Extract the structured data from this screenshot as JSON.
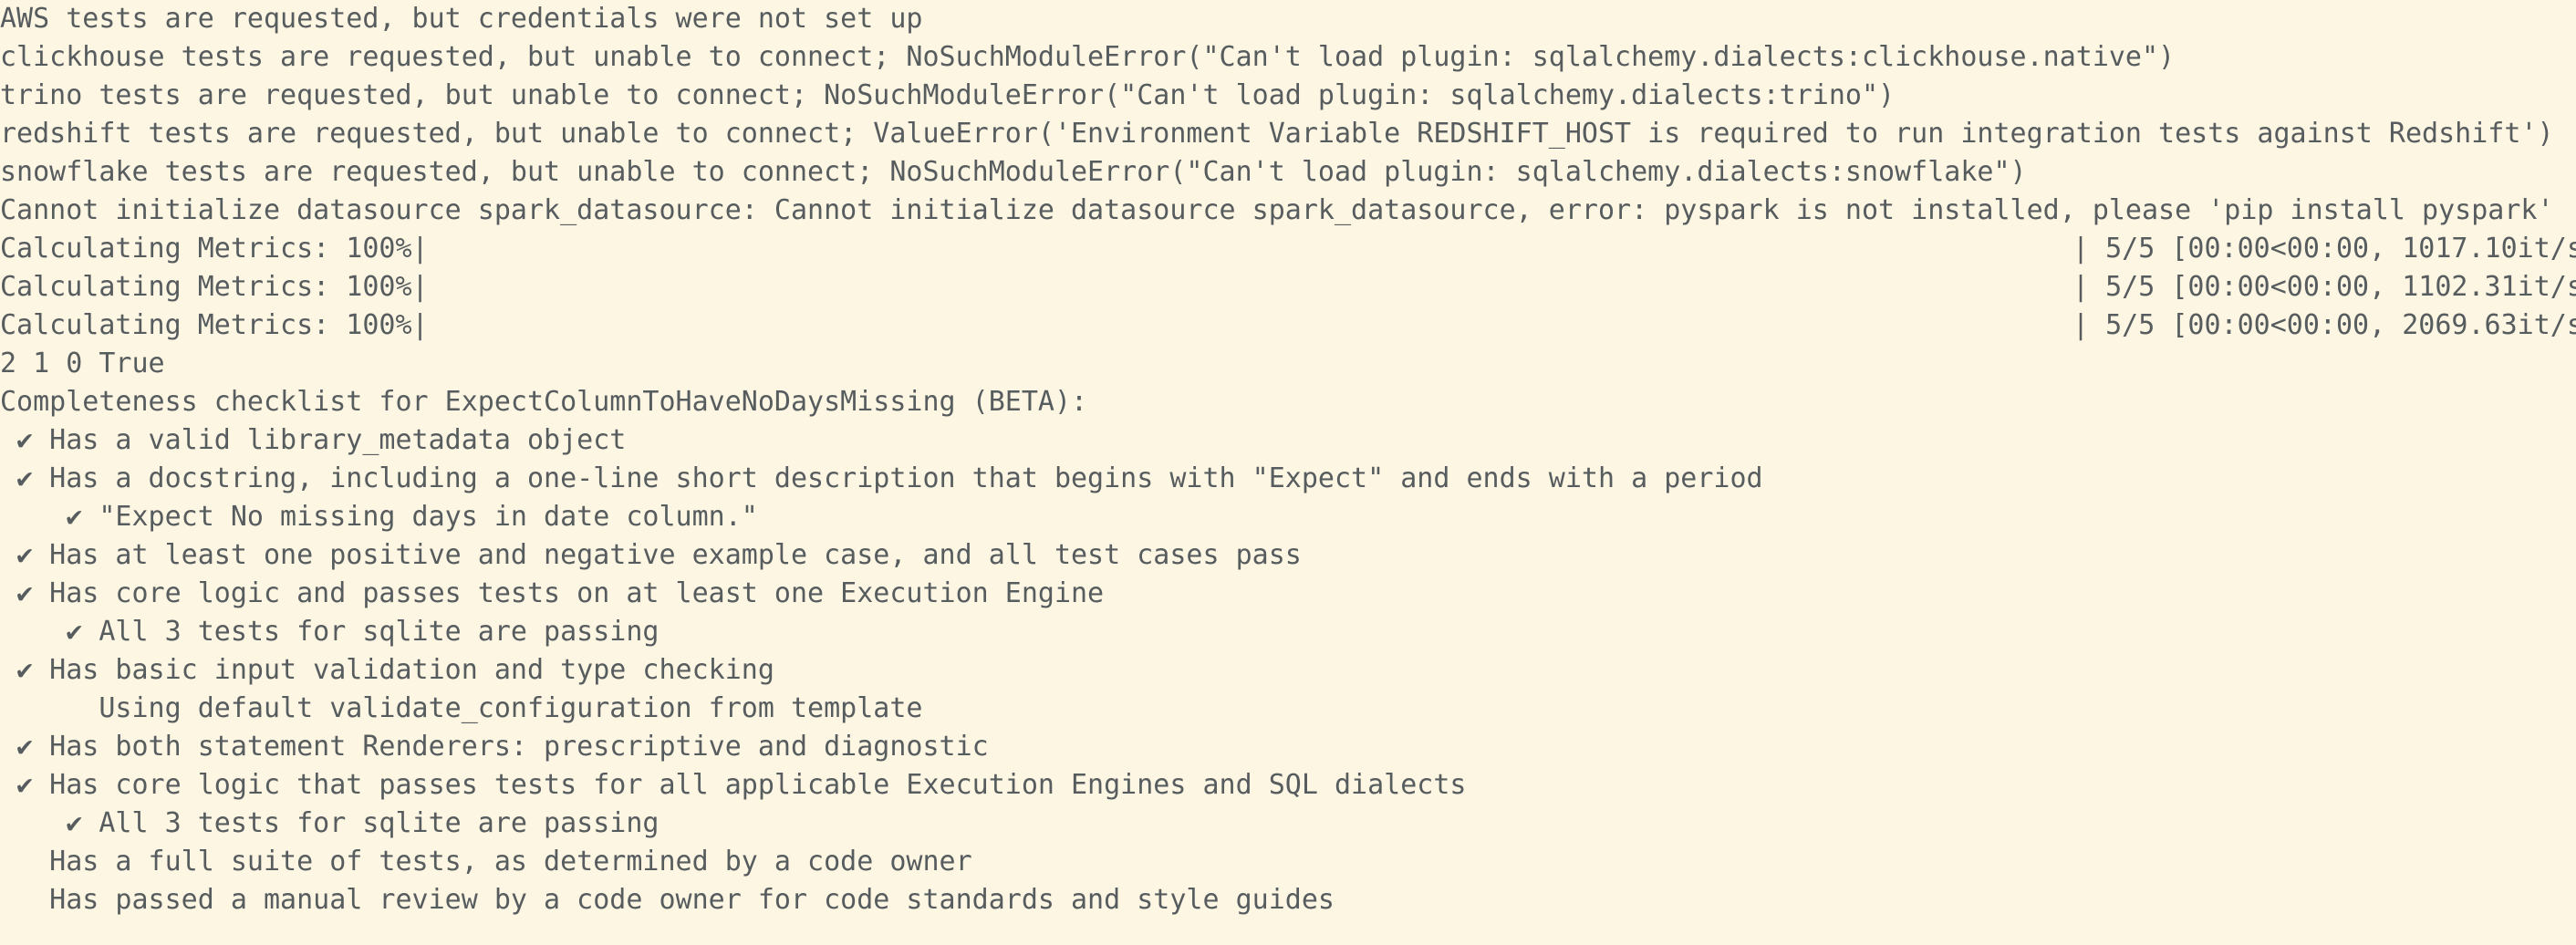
{
  "log": [
    "AWS tests are requested, but credentials were not set up",
    "clickhouse tests are requested, but unable to connect; NoSuchModuleError(\"Can't load plugin: sqlalchemy.dialects:clickhouse.native\")",
    "trino tests are requested, but unable to connect; NoSuchModuleError(\"Can't load plugin: sqlalchemy.dialects:trino\")",
    "redshift tests are requested, but unable to connect; ValueError('Environment Variable REDSHIFT_HOST is required to run integration tests against Redshift')",
    "snowflake tests are requested, but unable to connect; NoSuchModuleError(\"Can't load plugin: sqlalchemy.dialects:snowflake\")",
    "Cannot initialize datasource spark_datasource: Cannot initialize datasource spark_datasource, error: pyspark is not installed, please 'pip install pyspark'"
  ],
  "progress_bars": [
    {
      "label": "Calculating Metrics: 100%|",
      "percent": 100,
      "stats": "| 5/5 [00:00<00:00, 1017.10it/s"
    },
    {
      "label": "Calculating Metrics: 100%|",
      "percent": 100,
      "stats": "| 5/5 [00:00<00:00, 1102.31it/s"
    },
    {
      "label": "Calculating Metrics: 100%|",
      "percent": 100,
      "stats": "| 5/5 [00:00<00:00, 2069.63it/s"
    }
  ],
  "output": [
    "2 1 0 True",
    "Completeness checklist for ExpectColumnToHaveNoDaysMissing (BETA):",
    " ✔ Has a valid library_metadata object",
    " ✔ Has a docstring, including a one-line short description that begins with \"Expect\" and ends with a period",
    "    ✔ \"Expect No missing days in date column.\"",
    " ✔ Has at least one positive and negative example case, and all test cases pass",
    " ✔ Has core logic and passes tests on at least one Execution Engine",
    "    ✔ All 3 tests for sqlite are passing",
    " ✔ Has basic input validation and type checking",
    "      Using default validate_configuration from template",
    " ✔ Has both statement Renderers: prescriptive and diagnostic",
    " ✔ Has core logic that passes tests for all applicable Execution Engines and SQL dialects",
    "    ✔ All 3 tests for sqlite are passing",
    "   Has a full suite of tests, as determined by a code owner",
    "   Has passed a manual review by a code owner for code standards and style guides"
  ]
}
